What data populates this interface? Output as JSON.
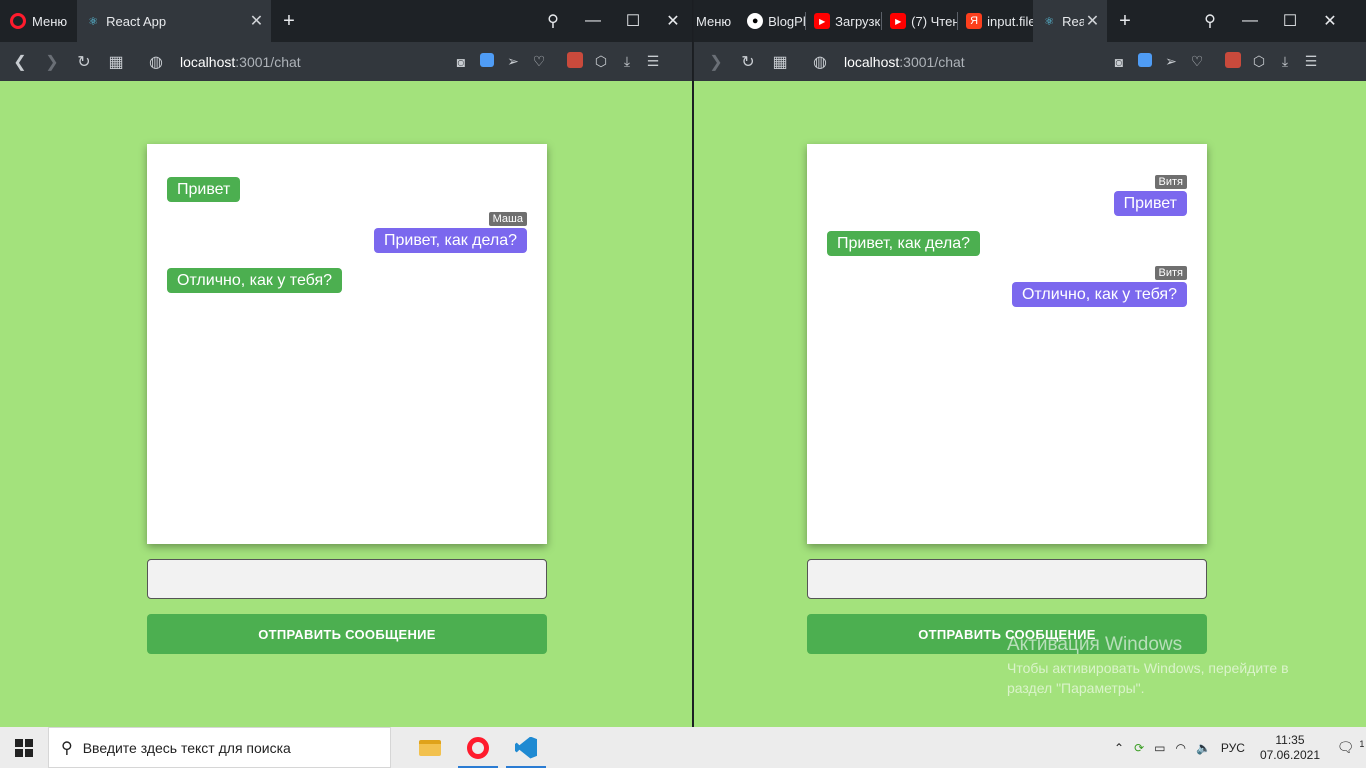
{
  "left_window": {
    "menu_label": "Меню",
    "tab_title": "React App",
    "url_host": "localhost",
    "url_path": ":3001/chat",
    "messages": [
      {
        "author": "",
        "text": "Привет",
        "side": "mine"
      },
      {
        "author": "Маша",
        "text": "Привет, как дела?",
        "side": "other"
      },
      {
        "author": "",
        "text": "Отлично, как у тебя?",
        "side": "mine"
      }
    ],
    "input_value": "",
    "send_label": "ОТПРАВИТЬ СООБЩЕНИЕ"
  },
  "right_window": {
    "menu_label": "Меню",
    "tabs": [
      {
        "title": "BlogPlan",
        "icon": "github-icon"
      },
      {
        "title": "Загрузка",
        "icon": "youtube-icon"
      },
      {
        "title": "(7) Чтен",
        "icon": "youtube-icon"
      },
      {
        "title": "input.file",
        "icon": "yandex-icon"
      },
      {
        "title": "React",
        "icon": "react-icon"
      }
    ],
    "url_host": "localhost",
    "url_path": ":3001/chat",
    "messages": [
      {
        "author": "Витя",
        "text": "Привет",
        "side": "other"
      },
      {
        "author": "",
        "text": "Привет, как дела?",
        "side": "mine"
      },
      {
        "author": "Витя",
        "text": "Отлично, как у тебя?",
        "side": "other"
      }
    ],
    "input_value": "",
    "send_label": "ОТПРАВИТЬ СООБЩЕНИЕ"
  },
  "watermark": {
    "title": "Активация Windows",
    "text": "Чтобы активировать Windows, перейдите в раздел \"Параметры\"."
  },
  "taskbar": {
    "search_placeholder": "Введите здесь текст для поиска",
    "language": "РУС",
    "time": "11:35",
    "date": "07.06.2021",
    "notification_count": "1"
  },
  "colors": {
    "page_bg": "#a3e27c",
    "mine_bubble": "#4caf50",
    "other_bubble": "#7b68ee",
    "send_button": "#4caf50"
  }
}
